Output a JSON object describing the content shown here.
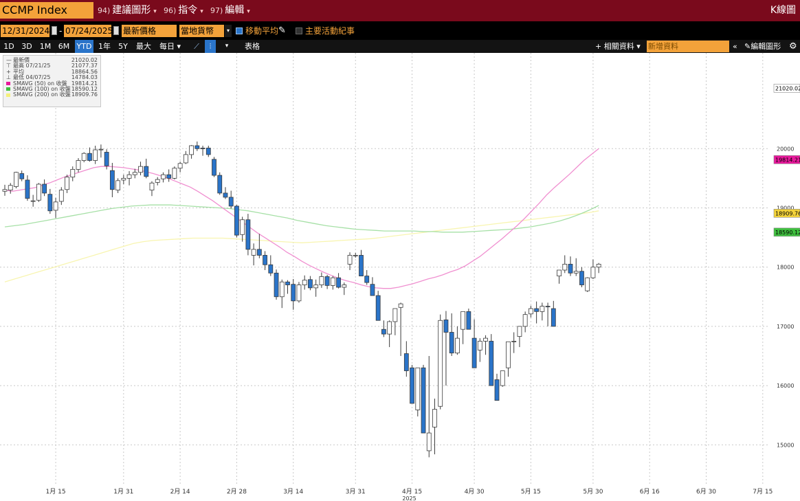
{
  "header": {
    "ticker": "CCMP Index",
    "menus": [
      {
        "num": "94)",
        "label": "建議圖形"
      },
      {
        "num": "96)",
        "label": "指令"
      },
      {
        "num": "97)",
        "label": "編輯"
      }
    ],
    "chart_kind": "K線圖"
  },
  "toolbar": {
    "start_date": "12/31/2024",
    "end_date": "07/24/2025",
    "price_mode": "最新價格",
    "view_mode": "當地貨幣",
    "moving_avg_label": "移動平均",
    "moving_avg_checked": true,
    "events_label": "主要活動紀事",
    "events_checked": false,
    "ranges": [
      "1D",
      "3D",
      "1M",
      "6M",
      "YTD",
      "1年",
      "5Y",
      "最大"
    ],
    "selected_range": "YTD",
    "period": "每日",
    "table_label": "表格",
    "related_label": "相關資料",
    "add_data_placeholder": "新增資料",
    "edit_label": "編輯圖形"
  },
  "legend": [
    {
      "sym": "—",
      "label": "最新價",
      "value": "21020.02"
    },
    {
      "sym": "⊤",
      "label": "最高 07/21/25",
      "value": "21077.37"
    },
    {
      "sym": "+",
      "label": "平均",
      "value": "18864.56"
    },
    {
      "sym": "⊥",
      "label": "最低 04/07/25",
      "value": "14784.03"
    },
    {
      "color": "#e8199c",
      "label": "SMAVG (50) on 收盤",
      "value": "19814.21"
    },
    {
      "color": "#3fbf3f",
      "label": "SMAVG (100) on 收盤",
      "value": "18590.12"
    },
    {
      "color": "#f5f07a",
      "label": "SMAVG (200) on 收盤",
      "value": "18909.76"
    }
  ],
  "chart_data": {
    "type": "candlestick",
    "title": "",
    "year_label": "2025",
    "ylim": [
      14400,
      21500
    ],
    "y_ticks": [
      15000,
      16000,
      17000,
      18000,
      19000,
      20000
    ],
    "grid": true,
    "x_ticks": [
      {
        "label": "1月 15",
        "i": 9
      },
      {
        "label": "1月 31",
        "i": 21
      },
      {
        "label": "2月 14",
        "i": 31
      },
      {
        "label": "2月 28",
        "i": 41
      },
      {
        "label": "3月 14",
        "i": 51
      },
      {
        "label": "3月 31",
        "i": 62
      },
      {
        "label": "4月 15",
        "i": 72
      },
      {
        "label": "4月 30",
        "i": 83
      },
      {
        "label": "5月 15",
        "i": 93
      },
      {
        "label": "5月 30",
        "i": 104
      },
      {
        "label": "6月 16",
        "i": 114
      },
      {
        "label": "6月 30",
        "i": 124
      },
      {
        "label": "7月 15",
        "i": 134
      }
    ],
    "candles": [
      [
        19281,
        19390,
        19205,
        19310
      ],
      [
        19300,
        19420,
        19240,
        19380
      ],
      [
        19360,
        19610,
        19330,
        19600
      ],
      [
        19580,
        19630,
        19450,
        19490
      ],
      [
        19470,
        19550,
        19120,
        19160
      ],
      [
        19110,
        19220,
        19020,
        19120
      ],
      [
        19130,
        19420,
        19100,
        19400
      ],
      [
        19400,
        19480,
        19200,
        19250
      ],
      [
        19230,
        19320,
        18900,
        18950
      ],
      [
        18960,
        19170,
        18830,
        19100
      ],
      [
        19110,
        19350,
        19050,
        19300
      ],
      [
        19310,
        19560,
        19250,
        19520
      ],
      [
        19520,
        19700,
        19450,
        19650
      ],
      [
        19650,
        19840,
        19600,
        19800
      ],
      [
        19800,
        19940,
        19770,
        19920
      ],
      [
        19920,
        20020,
        19780,
        19800
      ],
      [
        19800,
        20050,
        19740,
        19980
      ],
      [
        19980,
        20070,
        19850,
        19990
      ],
      [
        19940,
        19990,
        19650,
        19710
      ],
      [
        19630,
        19760,
        19180,
        19310
      ],
      [
        19300,
        19500,
        19250,
        19460
      ],
      [
        19470,
        19560,
        19400,
        19500
      ],
      [
        19500,
        19620,
        19380,
        19560
      ],
      [
        19560,
        19660,
        19500,
        19600
      ],
      [
        19600,
        19780,
        19550,
        19700
      ],
      [
        19700,
        19830,
        19500,
        19530
      ],
      [
        19300,
        19450,
        19200,
        19420
      ],
      [
        19430,
        19520,
        19380,
        19480
      ],
      [
        19490,
        19600,
        19430,
        19560
      ],
      [
        19560,
        19650,
        19440,
        19500
      ],
      [
        19500,
        19700,
        19480,
        19670
      ],
      [
        19670,
        19780,
        19600,
        19750
      ],
      [
        19760,
        19960,
        19740,
        19900
      ],
      [
        19900,
        20060,
        19830,
        20050
      ],
      [
        20050,
        20120,
        19960,
        20000
      ],
      [
        20010,
        20050,
        19880,
        20000
      ],
      [
        20010,
        20050,
        19860,
        19900
      ],
      [
        19820,
        19860,
        19520,
        19550
      ],
      [
        19550,
        19600,
        19220,
        19250
      ],
      [
        19250,
        19350,
        19150,
        19180
      ],
      [
        19180,
        19290,
        18990,
        19030
      ],
      [
        19030,
        19050,
        18500,
        18540
      ],
      [
        18550,
        18850,
        18430,
        18800
      ],
      [
        18800,
        18900,
        18200,
        18300
      ],
      [
        18200,
        18400,
        18030,
        18300
      ],
      [
        18300,
        18560,
        18150,
        18200
      ],
      [
        18200,
        18270,
        17950,
        18040
      ],
      [
        18040,
        18200,
        17850,
        17900
      ],
      [
        17900,
        17960,
        17450,
        17500
      ],
      [
        17500,
        17790,
        17310,
        17750
      ],
      [
        17750,
        17780,
        17550,
        17700
      ],
      [
        17710,
        17800,
        17280,
        17430
      ],
      [
        17430,
        17750,
        17400,
        17700
      ],
      [
        17700,
        17860,
        17620,
        17780
      ],
      [
        17790,
        17850,
        17610,
        17650
      ],
      [
        17650,
        17790,
        17500,
        17700
      ],
      [
        17700,
        17910,
        17650,
        17840
      ],
      [
        17840,
        17870,
        17630,
        17690
      ],
      [
        17690,
        17850,
        17620,
        17820
      ],
      [
        17820,
        17900,
        17640,
        17660
      ],
      [
        17660,
        17740,
        17530,
        17700
      ],
      [
        18050,
        18250,
        17950,
        18200
      ],
      [
        18200,
        18240,
        18160,
        18200
      ],
      [
        18200,
        18290,
        17850,
        17850
      ],
      [
        17850,
        17950,
        17700,
        17740
      ],
      [
        17710,
        17830,
        17520,
        17520
      ],
      [
        17520,
        17600,
        17100,
        17100
      ],
      [
        16950,
        17100,
        16820,
        16870
      ],
      [
        16870,
        17100,
        16650,
        17080
      ],
      [
        17080,
        17220,
        16850,
        17300
      ],
      [
        17320,
        17400,
        16500,
        17380
      ],
      [
        16540,
        16750,
        16150,
        16250
      ],
      [
        16300,
        16350,
        15700,
        15700
      ],
      [
        15590,
        16300,
        15480,
        16300
      ],
      [
        16300,
        16350,
        15500,
        15200
      ],
      [
        14900,
        16500,
        14790,
        15200
      ],
      [
        15300,
        15780,
        14840,
        15600
      ],
      [
        15650,
        17200,
        15600,
        17100
      ],
      [
        17110,
        17260,
        16000,
        16900
      ],
      [
        16900,
        17220,
        16500,
        16550
      ],
      [
        16550,
        17000,
        16520,
        16800
      ],
      [
        16950,
        17000,
        16700,
        17250
      ],
      [
        17250,
        17300,
        17050,
        16950
      ],
      [
        16800,
        17120,
        16550,
        16300
      ],
      [
        16600,
        16800,
        16400,
        16750
      ],
      [
        16750,
        16850,
        16520,
        16800
      ],
      [
        16750,
        16870,
        16150,
        16000
      ],
      [
        16100,
        16200,
        15800,
        15750
      ],
      [
        16000,
        16250,
        15980,
        16250
      ],
      [
        16300,
        16730,
        16150,
        16740
      ],
      [
        16750,
        16900,
        16550,
        16750
      ],
      [
        16830,
        17000,
        16650,
        17000
      ],
      [
        17000,
        17250,
        16900,
        17200
      ],
      [
        17210,
        17350,
        17150,
        17300
      ],
      [
        17300,
        17420,
        17050,
        17250
      ],
      [
        17250,
        17400,
        17100,
        17340
      ],
      [
        17340,
        17400,
        17000,
        17330
      ],
      [
        17300,
        17430,
        17220,
        17000
      ],
      [
        17850,
        17950,
        17720,
        17950
      ],
      [
        17950,
        18200,
        17900,
        18050
      ],
      [
        18050,
        18180,
        17850,
        17900
      ],
      [
        17900,
        18150,
        17850,
        17930
      ],
      [
        17930,
        18000,
        17660,
        17700
      ],
      [
        17600,
        17830,
        17580,
        17820
      ],
      [
        17820,
        18130,
        17800,
        18000
      ],
      [
        18000,
        18070,
        17900,
        18050
      ]
    ],
    "sma50": [
      19300,
      19280,
      19300,
      19320,
      19340,
      19380,
      19420,
      19470,
      19520,
      19560,
      19600,
      19640,
      19680,
      19700,
      19700,
      19690,
      19680,
      19660,
      19640,
      19610,
      19580,
      19540,
      19500,
      19450,
      19400,
      19350,
      19280,
      19200,
      19120,
      19030,
      18940,
      18850,
      18760,
      18670,
      18580,
      18500,
      18420,
      18340,
      18250,
      18180,
      18100,
      18030,
      17970,
      17910,
      17860,
      17810,
      17770,
      17740,
      17700,
      17670,
      17650,
      17640,
      17640,
      17660,
      17690,
      17720,
      17760,
      17800,
      17830,
      17870,
      17920,
      17960,
      18020,
      18100,
      18180,
      18280,
      18380,
      18480,
      18590,
      18700,
      18820,
      18950,
      19080,
      19220,
      19340,
      19450,
      19560,
      19680,
      19800,
      19900,
      20000
    ],
    "sma100": [
      18680,
      18700,
      18720,
      18750,
      18780,
      18810,
      18840,
      18870,
      18900,
      18930,
      18960,
      18990,
      19010,
      19030,
      19040,
      19050,
      19050,
      19050,
      19040,
      19030,
      19020,
      19010,
      19000,
      18990,
      18970,
      18950,
      18920,
      18890,
      18860,
      18830,
      18790,
      18760,
      18730,
      18700,
      18680,
      18660,
      18640,
      18630,
      18620,
      18610,
      18610,
      18610,
      18610,
      18600,
      18600,
      18590,
      18590,
      18590,
      18600,
      18610,
      18620,
      18630,
      18640,
      18660,
      18680,
      18710,
      18740,
      18780,
      18830,
      18890,
      18960,
      19040
    ],
    "sma200": [
      17750,
      17800,
      17850,
      17900,
      17950,
      18000,
      18050,
      18100,
      18150,
      18200,
      18250,
      18300,
      18350,
      18400,
      18430,
      18450,
      18460,
      18470,
      18480,
      18490,
      18490,
      18490,
      18490,
      18480,
      18470,
      18460,
      18450,
      18440,
      18430,
      18420,
      18410,
      18420,
      18430,
      18440,
      18450,
      18460,
      18470,
      18480,
      18500,
      18520,
      18540,
      18560,
      18580,
      18600,
      18620,
      18640,
      18660,
      18680,
      18700,
      18720,
      18740,
      18760,
      18780,
      18800,
      18820,
      18840,
      18860,
      18880,
      18900,
      18920,
      18950
    ]
  },
  "badges": {
    "last": {
      "value": "21020.02",
      "color": "#ffffff"
    },
    "sma50": {
      "value": "19814.21",
      "color": "#e8199c"
    },
    "sma200": {
      "value": "18909.76",
      "color": "#f3d33a"
    },
    "sma100": {
      "value": "18590.12",
      "color": "#3fbf3f"
    }
  },
  "colors": {
    "up": "#ffffff",
    "down": "#2a74c9",
    "sma50": "#f08fd0",
    "sma100": "#a6e0a6",
    "sma200": "#f8f5b0",
    "brand_bar": "#7a0a1c",
    "accent": "#f3a23a"
  }
}
